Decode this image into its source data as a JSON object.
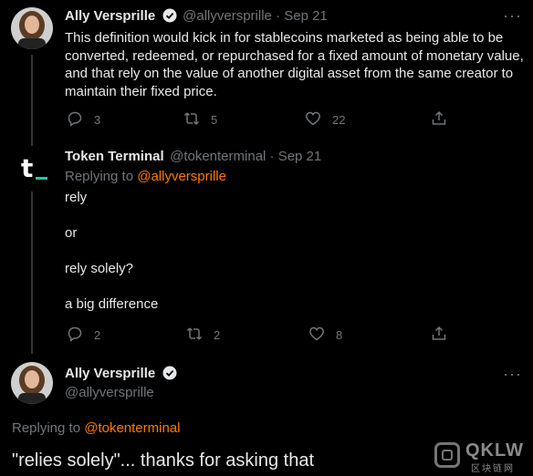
{
  "tweet1": {
    "name": "Ally Versprille",
    "handle_date": "@allyversprille · Sep 21",
    "text_lines": [
      "This definition would kick in for stablecoins marketed as being able to be",
      "converted, redeemed, or repurchased for a fixed amount of monetary value,",
      "and that rely on the value of another digital asset from the same creator to",
      "maintain their fixed price."
    ],
    "replies": "3",
    "retweets": "5",
    "likes": "22"
  },
  "tweet2": {
    "name": "Token Terminal",
    "handle_date": "@tokenterminal · Sep 21",
    "replying_prefix": "Replying to ",
    "replying_handle": "@allyversprille",
    "lines": [
      "rely",
      "or",
      "rely solely?",
      "a big difference"
    ],
    "replies": "2",
    "retweets": "2",
    "likes": "8",
    "logo_text": "t"
  },
  "tweet3": {
    "name": "Ally Versprille",
    "handle": "@allyversprille",
    "replying_prefix": "Replying to ",
    "replying_handle": "@tokenterminal",
    "text": "\"relies solely\"... thanks for asking that"
  },
  "more_glyph": "···",
  "watermark": {
    "brand": "QKLW",
    "sub": "区块链网"
  },
  "colors": {
    "background": "#000000",
    "accent": "#ff7a00",
    "muted": "#71767b",
    "text": "#e7e9ea"
  }
}
